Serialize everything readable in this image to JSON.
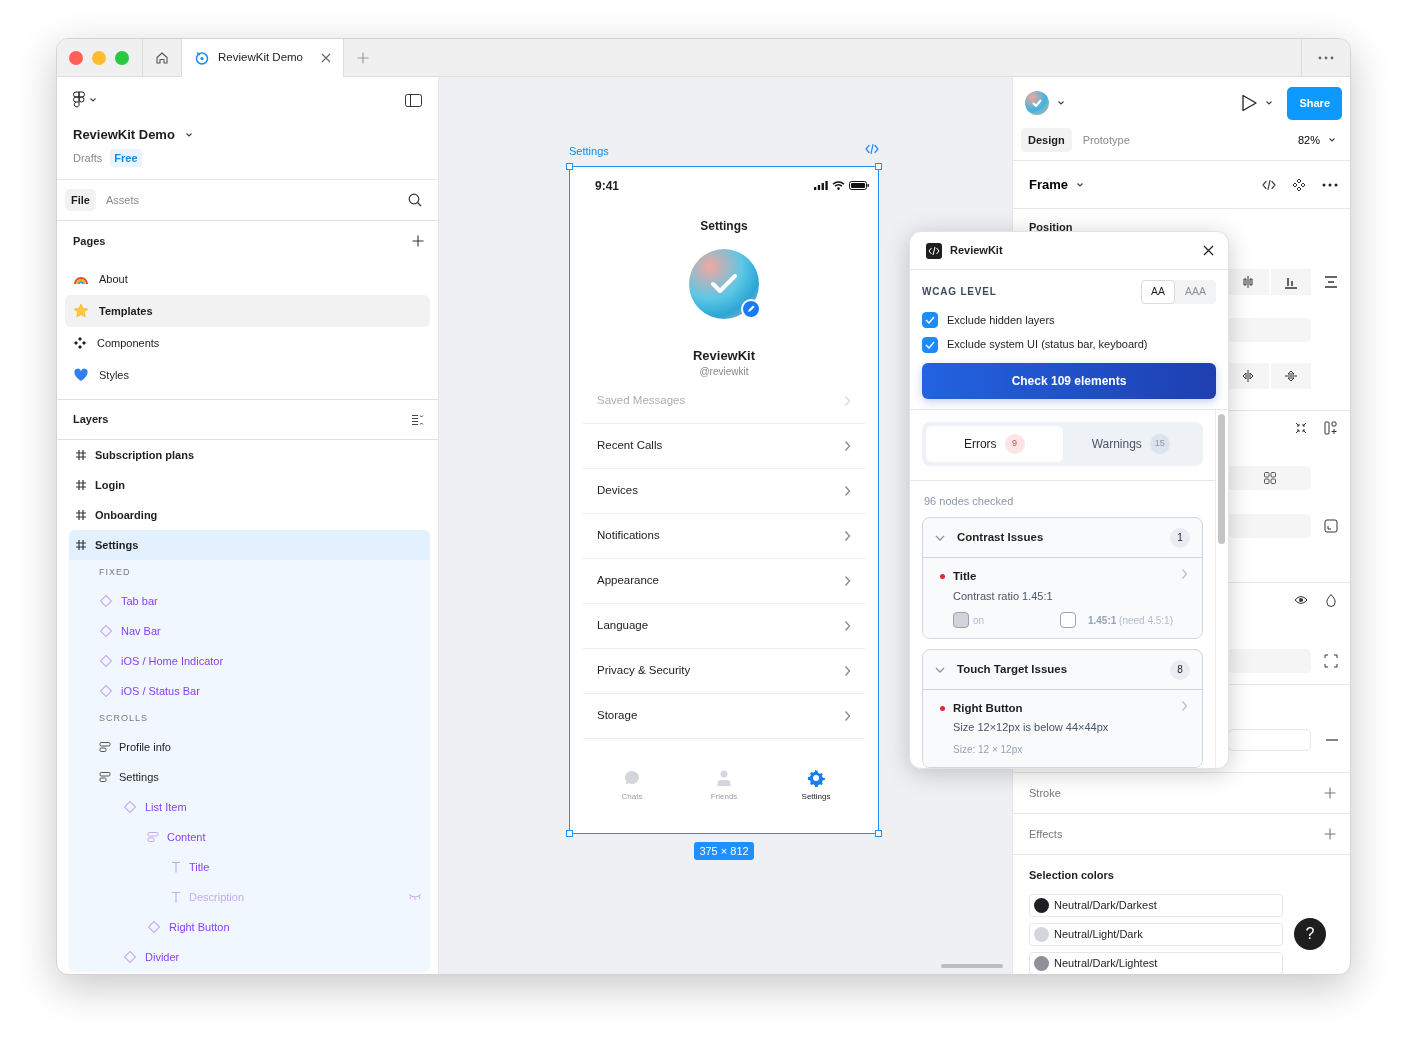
{
  "title_bar": {
    "tabs": [
      {
        "kind": "home",
        "selected": false
      },
      {
        "kind": "file",
        "label": "ReviewKit Demo",
        "selected": true
      }
    ]
  },
  "left_sidebar": {
    "file_name": "ReviewKit Demo",
    "location": "Drafts",
    "plan": "Free",
    "tabs": [
      {
        "label": "File",
        "selected": true
      },
      {
        "label": "Assets",
        "selected": false
      }
    ],
    "pages_title": "Pages",
    "pages": [
      {
        "kind": "rainbow",
        "label": "About",
        "selected": false
      },
      {
        "kind": "star",
        "label": "Templates",
        "selected": true
      },
      {
        "kind": "components",
        "label": "Components",
        "selected": false
      },
      {
        "kind": "heart",
        "label": "Styles",
        "selected": false
      }
    ],
    "layers_title": "Layers",
    "layers": [
      {
        "kind": "frame",
        "label": "Subscription plans",
        "selected": false
      },
      {
        "kind": "frame",
        "label": "Login",
        "selected": false
      },
      {
        "kind": "frame",
        "label": "Onboarding",
        "selected": false
      },
      {
        "kind": "frame",
        "label": "Settings",
        "selected": true,
        "children": [
          {
            "kind": "section",
            "label": "FIXED"
          },
          {
            "kind": "component",
            "label": "Tab bar"
          },
          {
            "kind": "component",
            "label": "Nav Bar"
          },
          {
            "kind": "component",
            "label": "iOS / Home Indicator"
          },
          {
            "kind": "component",
            "label": "iOS / Status Bar"
          },
          {
            "kind": "section",
            "label": "SCROLLS"
          },
          {
            "kind": "stack",
            "label": "Profile info"
          },
          {
            "kind": "stack",
            "label": "Settings",
            "children": [
              {
                "kind": "component",
                "label": "List Item",
                "children": [
                  {
                    "kind": "stack",
                    "label": "Content",
                    "children": [
                      {
                        "kind": "text",
                        "label": "Title",
                        "hidden": false
                      },
                      {
                        "kind": "text",
                        "label": "Description",
                        "hidden": true
                      }
                    ]
                  },
                  {
                    "kind": "component",
                    "label": "Right Button"
                  }
                ]
              },
              {
                "kind": "component",
                "label": "Divider"
              }
            ]
          }
        ]
      }
    ]
  },
  "canvas": {
    "frame_label": "Settings",
    "size": "375 × 812",
    "phone": {
      "time": "9:41",
      "title": "Settings",
      "name": "ReviewKit",
      "handle": "@reviewkit",
      "rows": [
        {
          "label": "Saved Messages",
          "faded": true
        },
        {
          "label": "Recent Calls",
          "faded": false
        },
        {
          "label": "Devices",
          "faded": false
        },
        {
          "label": "Notifications",
          "faded": false
        },
        {
          "label": "Appearance",
          "faded": false
        },
        {
          "label": "Language",
          "faded": false
        },
        {
          "label": "Privacy & Security",
          "faded": false
        },
        {
          "label": "Storage",
          "faded": false
        }
      ],
      "tabs": [
        {
          "kind": "chat",
          "label": "Chats",
          "selected": false
        },
        {
          "kind": "person",
          "label": "Friends",
          "selected": false
        },
        {
          "kind": "gear",
          "label": "Settings",
          "selected": true
        }
      ]
    }
  },
  "plugin": {
    "title": "ReviewKit",
    "wcag_label": "WCAG LEVEL",
    "levels": [
      {
        "label": "AA",
        "selected": true
      },
      {
        "label": "AAA",
        "selected": false
      }
    ],
    "options": [
      {
        "label": "Exclude hidden layers",
        "checked": true
      },
      {
        "label": "Exclude system UI (status bar, keyboard)",
        "checked": true
      }
    ],
    "check_button": "Check 109 elements",
    "result_tabs": [
      {
        "kind": "error",
        "label": "Errors",
        "count": "9",
        "selected": true
      },
      {
        "kind": "warning",
        "label": "Warnings",
        "count": "15",
        "selected": false
      }
    ],
    "summary": "96 nodes checked",
    "groups": [
      {
        "title": "Contrast Issues",
        "count": "1",
        "expanded": true,
        "issues": [
          {
            "kind": "contrast",
            "title": "Title",
            "detail": "Contrast ratio 1.45:1",
            "swatches": [
              {
                "color": "#d1d5db"
              },
              {
                "color": "#ffffff"
              }
            ],
            "joiner": "on",
            "ratio": "**1.45:1** (need 4.5:1)"
          }
        ]
      },
      {
        "title": "Touch Target Issues",
        "count": "8",
        "expanded": true,
        "issues": [
          {
            "kind": "touch",
            "title": "Right Button",
            "detail": "Size 12×12px is below 44×44px",
            "meta": "Size: 12 × 12px"
          }
        ]
      }
    ]
  },
  "right_panel": {
    "share": "Share",
    "tabs": [
      {
        "label": "Design",
        "selected": true
      },
      {
        "label": "Prototype",
        "selected": false
      }
    ],
    "zoom": "82%",
    "selection_title": "Frame",
    "position_label": "Position",
    "sections": [
      {
        "title": "Stroke"
      },
      {
        "title": "Effects"
      }
    ],
    "colors_title": "Selection colors",
    "colors": [
      {
        "name": "Neutral/Dark/Darkest",
        "color": "#1f2025"
      },
      {
        "name": "Neutral/Light/Dark",
        "color": "#d4d6dd"
      },
      {
        "name": "Neutral/Dark/Lightest",
        "color": "#8f9099"
      }
    ],
    "help": "?"
  }
}
